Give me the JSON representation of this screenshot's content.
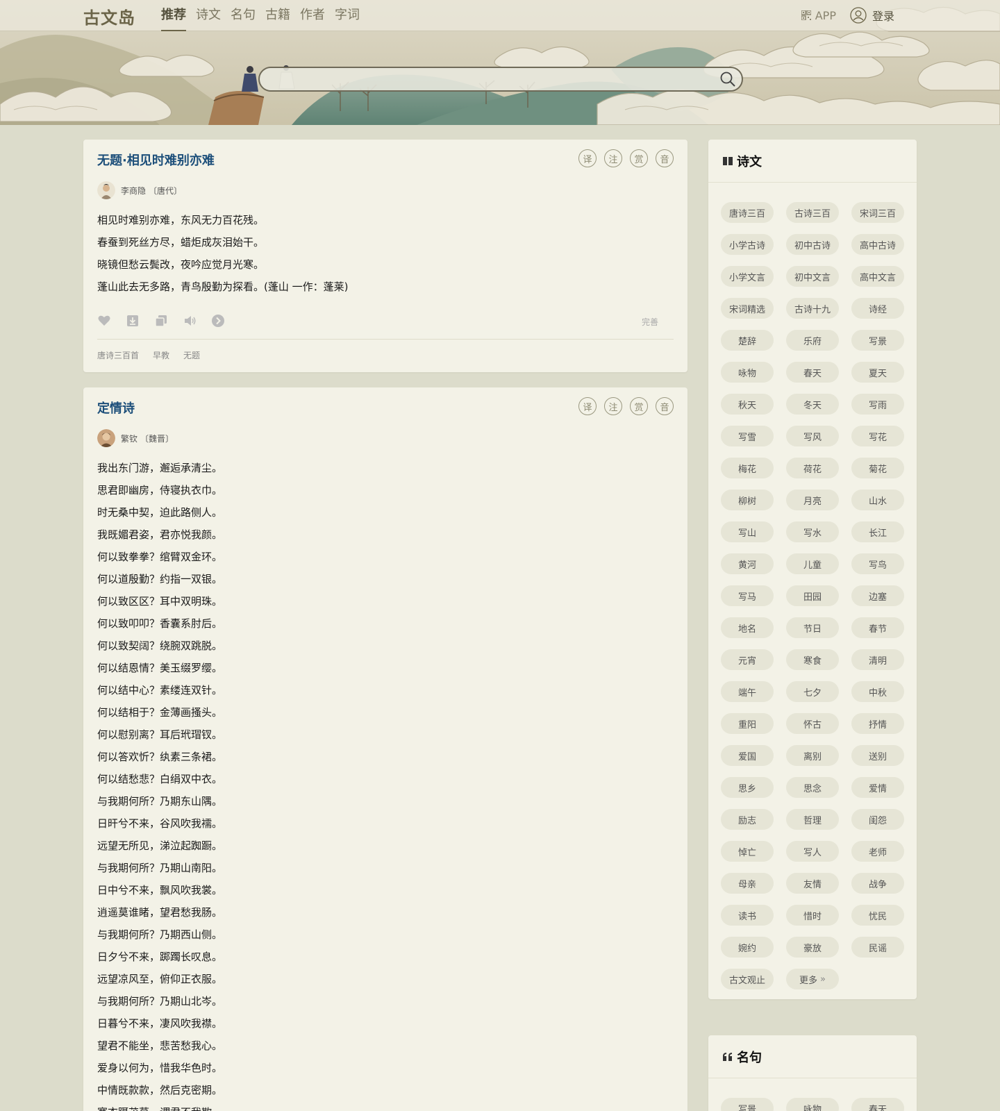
{
  "header": {
    "logo": "古文岛",
    "nav": [
      "推荐",
      "诗文",
      "名句",
      "古籍",
      "作者",
      "字词"
    ],
    "app_label": "APP",
    "login_label": "登录",
    "search_placeholder": ""
  },
  "poems": [
    {
      "title": "无题·相见时难别亦难",
      "tools": [
        "译",
        "注",
        "赏",
        "音"
      ],
      "author": "李商隐",
      "dynasty": "〔唐代〕",
      "lines": [
        "相见时难别亦难，东风无力百花残。",
        "春蚕到死丝方尽，蜡炬成灰泪始干。",
        "晓镜但愁云鬓改，夜吟应觉月光寒。",
        "蓬山此去无多路，青鸟殷勤为探看。(蓬山 一作：蓬莱)"
      ],
      "perfect_label": "完善",
      "tags": [
        "唐诗三百首",
        "早教",
        "无题"
      ]
    },
    {
      "title": "定情诗",
      "tools": [
        "译",
        "注",
        "赏",
        "音"
      ],
      "author": "繁钦",
      "dynasty": "〔魏晋〕",
      "lines": [
        "我出东门游，邂逅承清尘。",
        "思君即幽房，侍寝执衣巾。",
        "时无桑中契，迫此路侧人。",
        "我既媚君姿，君亦悦我颜。",
        "何以致拳拳？绾臂双金环。",
        "何以道殷勤？约指一双银。",
        "何以致区区？耳中双明珠。",
        "何以致叩叩？香囊系肘后。",
        "何以致契阔？绕腕双跳脱。",
        "何以结恩情？美玉缀罗缨。",
        "何以结中心？素缕连双针。",
        "何以结相于？金薄画搔头。",
        "何以慰别离？耳后玳瑁钗。",
        "何以答欢忻？纨素三条裙。",
        "何以结愁悲？白绢双中衣。",
        "与我期何所？乃期东山隅。",
        "日旰兮不来，谷风吹我襦。",
        "远望无所见，涕泣起踟蹰。",
        "与我期何所？乃期山南阳。",
        "日中兮不来，飘风吹我裳。",
        "逍遥莫谁睹，望君愁我肠。",
        "与我期何所？乃期西山侧。",
        "日夕兮不来，踯躅长叹息。",
        "远望凉风至，俯仰正衣服。",
        "与我期何所？乃期山北岑。",
        "日暮兮不来，凄风吹我襟。",
        "望君不能坐，悲苦愁我心。",
        "爱身以何为，惜我华色时。",
        "中情既款款，然后克密期。",
        "褰衣蹑茂草，谓君不我欺。"
      ]
    }
  ],
  "sidebar": {
    "poetry": {
      "title": "诗文",
      "chips": [
        "唐诗三百",
        "古诗三百",
        "宋词三百",
        "小学古诗",
        "初中古诗",
        "高中古诗",
        "小学文言",
        "初中文言",
        "高中文言",
        "宋词精选",
        "古诗十九",
        "诗经",
        "楚辞",
        "乐府",
        "写景",
        "咏物",
        "春天",
        "夏天",
        "秋天",
        "冬天",
        "写雨",
        "写雪",
        "写风",
        "写花",
        "梅花",
        "荷花",
        "菊花",
        "柳树",
        "月亮",
        "山水",
        "写山",
        "写水",
        "长江",
        "黄河",
        "儿童",
        "写鸟",
        "写马",
        "田园",
        "边塞",
        "地名",
        "节日",
        "春节",
        "元宵",
        "寒食",
        "清明",
        "端午",
        "七夕",
        "中秋",
        "重阳",
        "怀古",
        "抒情",
        "爱国",
        "离别",
        "送别",
        "思乡",
        "思念",
        "爱情",
        "励志",
        "哲理",
        "闺怨",
        "悼亡",
        "写人",
        "老师",
        "母亲",
        "友情",
        "战争",
        "读书",
        "惜时",
        "忧民",
        "婉约",
        "豪放",
        "民谣",
        "古文观止"
      ],
      "more_label": "更多"
    },
    "quotes": {
      "title": "名句",
      "chips": [
        "写景",
        "咏物",
        "春天"
      ]
    }
  },
  "colors": {
    "background": "#dcdccb",
    "card": "#f3f2e7",
    "title_link": "#1d4f7a",
    "chip": "#e6e5d6"
  }
}
